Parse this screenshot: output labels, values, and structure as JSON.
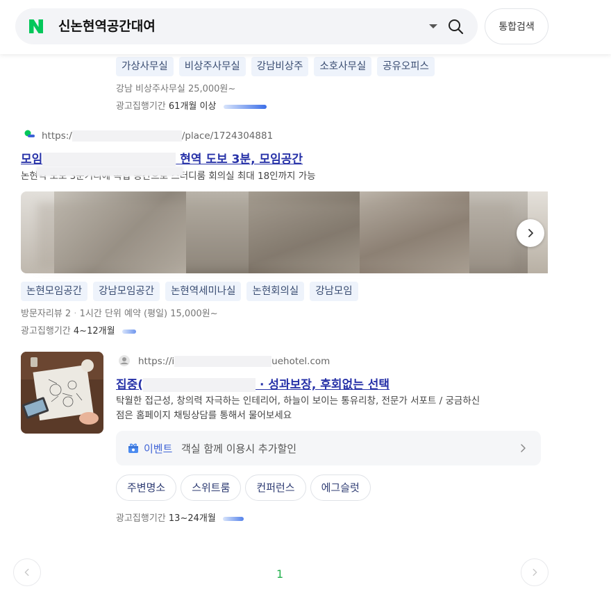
{
  "search": {
    "query": "신논현역공간대여",
    "total_search_label": "통합검색"
  },
  "ad1": {
    "chips": [
      "가상사무실",
      "비상주사무실",
      "강남비상주",
      "소호사무실",
      "공유오피스"
    ],
    "price_info": "강남 비상주사무실 25,000원~",
    "ad_period_label": "광고집행기간",
    "ad_period_value": "61개월 이상",
    "ad_level": 1.0
  },
  "ad2": {
    "url_prefix": "https:/",
    "url_suffix": "/place/1724304881",
    "title_start": "모임",
    "title_end": "현역 도보 3분, 모임공간",
    "desc": "논현역 도보 3분거리에 독립 공간으로 스터디룸 회의실 최대 18인까지 가능",
    "chips": [
      "논현모임공간",
      "강남모임공간",
      "논현역세미나실",
      "논현회의실",
      "강남모임"
    ],
    "info_reviews": "방문자리뷰 2",
    "info_price": "1시간 단위 예약 (평일) 15,000원~",
    "ad_period_label": "광고집행기간",
    "ad_period_value": "4~12개월",
    "ad_level": 0.33,
    "photo_colors": [
      "#c8c4bc",
      "#b9b4ab",
      "#a39c92",
      "#c0bdb6",
      "#8e8478",
      "#b7b1a8",
      "#d2cec6"
    ]
  },
  "ad3": {
    "url_prefix": "https://i",
    "url_suffix": "uehotel.com",
    "title_start": "집중(",
    "title_end": "· 성과보장, 후회없는 선택",
    "desc_line1": "탁월한 접근성, 창의력 자극하는 인테리어, 하늘이 보이는 통유리창, 전문가 서포트 / 궁금하신",
    "desc_line2": "점은 홈페이지 채팅상담를 통해서 물어보세요",
    "event_label": "이벤트",
    "event_text": "객실 함께 이용시 추가할인",
    "pills": [
      "주변명소",
      "스위트룸",
      "컨퍼런스",
      "에그슬럿"
    ],
    "ad_period_label": "광고집행기간",
    "ad_period_value": "13~24개월",
    "ad_level": 0.5
  },
  "pagination": {
    "current_page": "1"
  },
  "colors": {
    "brand_green": "#03c75a",
    "link_blue": "#2732a8",
    "page_green": "#23b14d"
  },
  "icons": [
    "naver-logo-icon",
    "dropdown-caret-icon",
    "search-icon",
    "chevron-right-icon",
    "event-gift-icon",
    "chevron-left-icon",
    "globe-favicon-icon",
    "place-pin-favicon-icon"
  ]
}
